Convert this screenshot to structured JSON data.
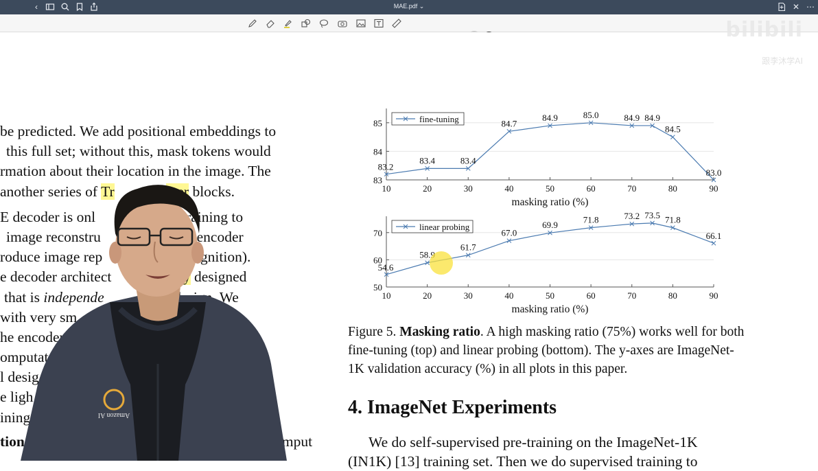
{
  "window": {
    "title": "MAE.pdf ⌄"
  },
  "toolbar_icons": [
    "back-icon",
    "sidebar-icon",
    "search-icon",
    "bookmark-icon",
    "share-icon"
  ],
  "annotation_tools": [
    "pencil-icon",
    "eraser-icon",
    "highlighter-icon",
    "shapes-icon",
    "lasso-icon",
    "camera-icon",
    "image-icon",
    "text-box-icon",
    "ruler-icon"
  ],
  "colors": {
    "swatch1": "#f0f08a",
    "swatch2": "#8fe08a",
    "swatch3": "#9be8f0",
    "small_dot": "#222222",
    "dot_dark1": "#444444",
    "dot_dark2": "#333333",
    "highlight": "#fff03c",
    "line_color": "#4a7ab0"
  },
  "watermark": {
    "logo": "bilibili",
    "sub": "跟李沐学AI"
  },
  "left_text": {
    "l1": "be predicted. We add positional embeddings to",
    "l2": "this full set; without this, mask tokens would",
    "l3": "rmation about their location in the image. The",
    "l4a": "another series of ",
    "l4b": "Tr",
    "l4c": "mer",
    "l4d": " blocks.",
    "l5": "E decoder is onl              g pre-training to",
    "l6": "image reconstru              nly the encoder",
    "l7": "roduce image rep              for recognition).",
    "l8a": "e decoder architect         ",
    "l8b": "flexibly",
    "l8c": " designed",
    "l9a": "that is ",
    "l9b": "independe",
    "l9c": "         coder design. We",
    "l10": "with very sm              ver and shal-",
    "l11": "he encoder              t decoder",
    "l12": "omputat                    With this",
    "l13": "l desig                        y pro-",
    "l14": "e ligh                          ly re-",
    "l15": "ining",
    "l16a": "tion",
    "l16b": "mput"
  },
  "chart_data": [
    {
      "type": "line",
      "series": [
        {
          "name": "fine-tuning",
          "x": [
            10,
            20,
            30,
            40,
            50,
            60,
            70,
            75,
            80,
            90
          ],
          "values": [
            83.2,
            83.4,
            83.4,
            84.7,
            84.9,
            85.0,
            84.9,
            84.9,
            84.5,
            83.0
          ]
        }
      ],
      "xlabel": "masking ratio (%)",
      "ylabel": "",
      "xlim": [
        10,
        90
      ],
      "ylim": [
        83,
        85.5
      ],
      "xticks": [
        10,
        20,
        30,
        40,
        50,
        60,
        70,
        80,
        90
      ],
      "yticks": [
        83,
        84,
        85
      ],
      "labels": [
        "83.2",
        "83.4",
        "83.4",
        "84.7",
        "84.9",
        "85.0",
        "84.9",
        "84.9",
        "84.5",
        "83.0"
      ],
      "legend": "top-left",
      "grid": true
    },
    {
      "type": "line",
      "series": [
        {
          "name": "linear probing",
          "x": [
            10,
            20,
            30,
            40,
            50,
            60,
            70,
            75,
            80,
            90
          ],
          "values": [
            54.6,
            58.9,
            61.7,
            67.0,
            69.9,
            71.8,
            73.2,
            73.5,
            71.8,
            66.1
          ]
        }
      ],
      "xlabel": "masking ratio (%)",
      "ylabel": "",
      "xlim": [
        10,
        90
      ],
      "ylim": [
        50,
        76
      ],
      "xticks": [
        10,
        20,
        30,
        40,
        50,
        60,
        70,
        80,
        90
      ],
      "yticks": [
        50,
        60,
        70
      ],
      "labels": [
        "54.6",
        "58.9",
        "61.7",
        "67.0",
        "69.9",
        "71.8",
        "73.2",
        "73.5",
        "71.8",
        "66.1"
      ],
      "legend": "top-left",
      "grid": true
    }
  ],
  "caption": {
    "prefix": "Figure 5. ",
    "bold": "Masking ratio",
    "rest": ". A high masking ratio (75%) works well for both fine-tuning (top) and linear probing (bottom). The y-axes are ImageNet-1K validation accuracy (%) in all plots in this paper."
  },
  "section_title": "4. ImageNet Experiments",
  "body_para": "We do self-supervised pre-training on the ImageNet-1K",
  "body_para2": "(IN1K) [13] training set. Then we do supervised training to",
  "shirt_logo": "Amazon AI"
}
